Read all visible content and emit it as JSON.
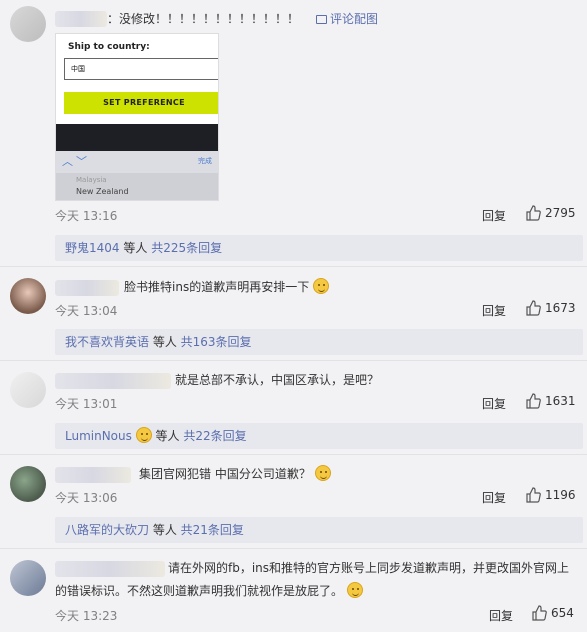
{
  "comments": [
    {
      "text": "：没修改！！！！！！！！！！！！",
      "view_image_label": "评论配图",
      "embedded_image": {
        "ship_label": "Ship to country:",
        "country_value": "中国",
        "button_label": "SET PREFERENCE",
        "done_label": "完成",
        "picker_prev": "Malaysia",
        "picker_current": "New Zealand"
      },
      "time": "今天 13:16",
      "reply_label": "回复",
      "likes": "2795",
      "sub": {
        "user": "野鬼1404",
        "mid": " 等人 ",
        "count": "共225条回复"
      }
    },
    {
      "text": "脸书推特ins的道歉声明再安排一下",
      "time": "今天 13:04",
      "reply_label": "回复",
      "likes": "1673",
      "sub": {
        "user": "我不喜欢背英语",
        "mid": " 等人 ",
        "count": "共163条回复"
      }
    },
    {
      "text": "就是总部不承认，中国区承认，是吧？",
      "time": "今天 13:01",
      "reply_label": "回复",
      "likes": "1631",
      "sub": {
        "user": "LuminNous",
        "mid": " 等人 ",
        "count": "共22条回复"
      }
    },
    {
      "text": "集团官网犯错  中国分公司道歉？",
      "time": "今天 13:06",
      "reply_label": "回复",
      "likes": "1196",
      "sub": {
        "user": "八路军的大砍刀",
        "mid": " 等人 ",
        "count": "共21条回复"
      }
    },
    {
      "text_line1": "请在外网的fb，ins和推特的官方账号上同步发道歉声明，并更改国外官网上",
      "text_line2": "的错误标识。不然这则道歉声明我们就视作是放屁了。",
      "time": "今天 13:23",
      "reply_label": "回复",
      "likes": "654"
    }
  ],
  "colors": {
    "link_blue": "#5a6fae",
    "accent_button": "#cde200"
  }
}
